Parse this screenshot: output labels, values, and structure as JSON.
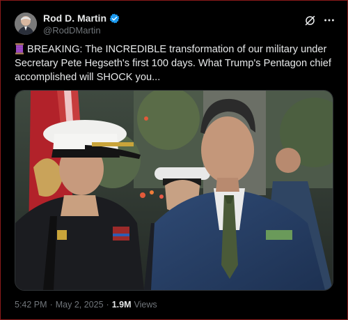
{
  "author": {
    "display_name": "Rod D. Martin",
    "handle": "@RodDMartin",
    "verified": true,
    "verified_color": "#1d9bf0"
  },
  "actions": {
    "grok_icon": "grok-icon",
    "more_icon": "more-icon"
  },
  "tweet": {
    "text": "BREAKING: The INCREDIBLE transformation of our military under Secretary Pete Hegseth's first 100 days. What Trump's Pentagon chief accomplished will SHOCK you...",
    "leading_emoji": "thread-spool-emoji"
  },
  "meta": {
    "time": "5:42 PM",
    "date": "May 2, 2025",
    "separator": "·",
    "views_count": "1.9M",
    "views_label": "Views"
  }
}
